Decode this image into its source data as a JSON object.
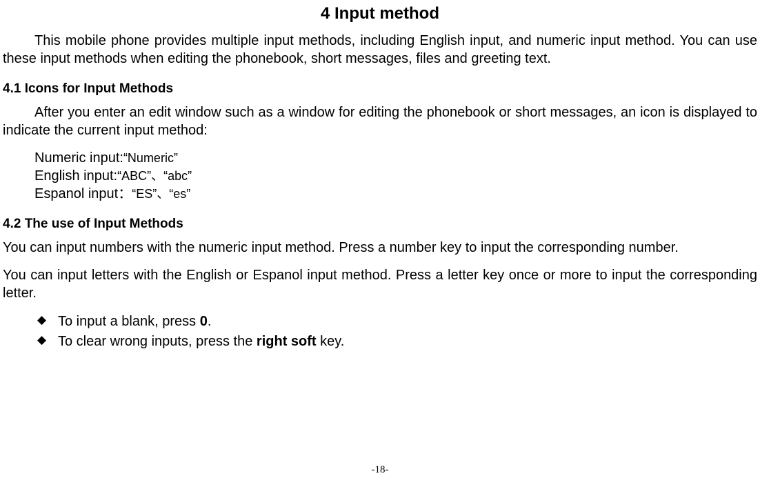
{
  "title": "4 Input method",
  "intro": "This mobile phone provides multiple input methods, including English input, and numeric input method. You can use these input methods when editing the phonebook, short messages, files and greeting text.",
  "section41": {
    "heading": "4.1  Icons for Input Methods",
    "lead": "After you enter an edit window such as a window for editing the phonebook or short messages, an icon is displayed to indicate the current input method:",
    "numeric_label": "Numeric input:",
    "numeric_icons": "“Numeric”",
    "english_label": "English input:",
    "english_icons": "“ABC”、“abc”",
    "espanol_label": "Espanol input：",
    "espanol_icons": "“ES”、“es”"
  },
  "section42": {
    "heading": "4.2  The use of Input Methods",
    "p1": "You can input numbers with the numeric input method. Press a number key to input the corresponding number.",
    "p2": "You can input letters with the English or Espanol input method. Press a letter key once or more to input the corresponding letter.",
    "bullet1_a": "To input a blank, press ",
    "bullet1_b": "0",
    "bullet1_c": ".",
    "bullet2_a": "To clear wrong inputs, press the ",
    "bullet2_b": "right soft",
    "bullet2_c": " key."
  },
  "pagenum": "-18-"
}
